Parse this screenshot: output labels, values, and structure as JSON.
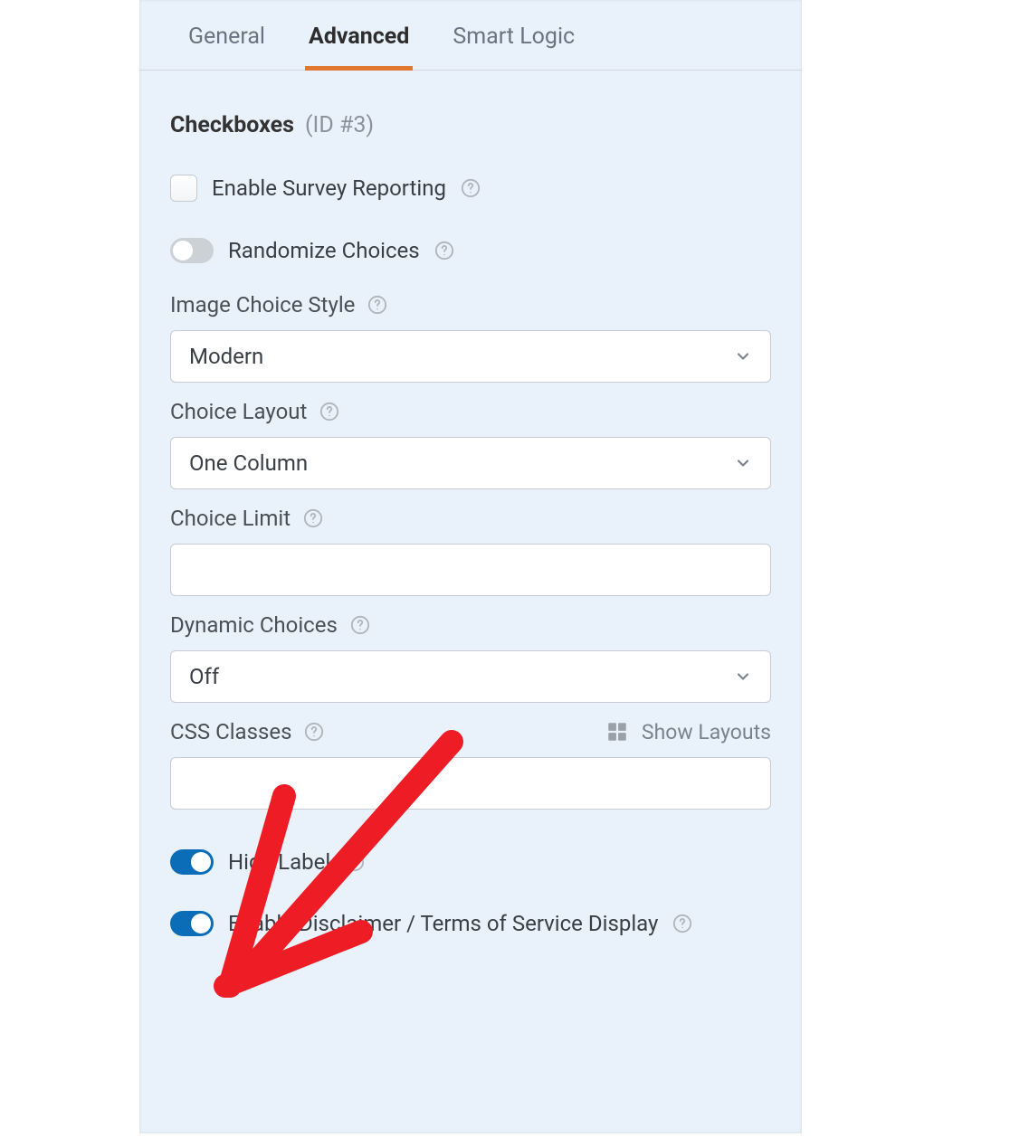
{
  "tabs": {
    "general": "General",
    "advanced": "Advanced",
    "smart_logic": "Smart Logic"
  },
  "header": {
    "title": "Checkboxes",
    "id_text": "(ID #3)"
  },
  "enable_survey": {
    "label": "Enable Survey Reporting"
  },
  "randomize": {
    "label": "Randomize Choices"
  },
  "image_choice_style": {
    "label": "Image Choice Style",
    "value": "Modern"
  },
  "choice_layout": {
    "label": "Choice Layout",
    "value": "One Column"
  },
  "choice_limit": {
    "label": "Choice Limit",
    "value": ""
  },
  "dynamic_choices": {
    "label": "Dynamic Choices",
    "value": "Off"
  },
  "css_classes": {
    "label": "CSS Classes",
    "show_layouts": "Show Layouts",
    "value": ""
  },
  "hide_label": {
    "label": "Hide Label"
  },
  "enable_disclaimer": {
    "label": "Enable Disclaimer / Terms of Service Display"
  }
}
